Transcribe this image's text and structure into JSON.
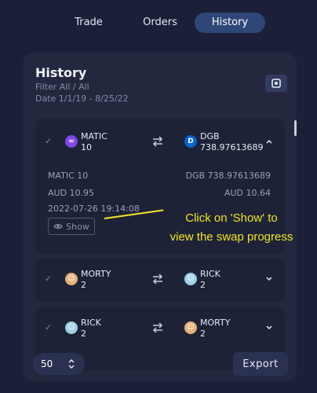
{
  "tabs": [
    {
      "label": "Trade",
      "active": false
    },
    {
      "label": "Orders",
      "active": false
    },
    {
      "label": "History",
      "active": true
    }
  ],
  "panel": {
    "title": "History",
    "filter": "Filter All / All",
    "date": "Date 1/1/19 - 8/25/22"
  },
  "swaps": [
    {
      "from": {
        "ticker": "MATIC",
        "amount": "10",
        "icon": "matic-icon",
        "color": "#8247e5"
      },
      "to": {
        "ticker": "DGB",
        "amount": "738.97613689",
        "icon": "dgb-icon",
        "color": "#0066cc"
      },
      "expanded": true,
      "details": {
        "from_amount": "MATIC 10",
        "to_amount": "DGB 738.97613689",
        "from_fiat": "AUD 10.95",
        "to_fiat": "AUD 10.64",
        "timestamp": "2022-07-26 19:14:08",
        "show_label": "Show"
      }
    },
    {
      "from": {
        "ticker": "MORTY",
        "amount": "2",
        "icon": "morty-icon",
        "color": "#e8b07a"
      },
      "to": {
        "ticker": "RICK",
        "amount": "2",
        "icon": "rick-icon",
        "color": "#9fd0e6"
      },
      "expanded": false
    },
    {
      "from": {
        "ticker": "RICK",
        "amount": "2",
        "icon": "rick-icon",
        "color": "#9fd0e6"
      },
      "to": {
        "ticker": "MORTY",
        "amount": "2",
        "icon": "morty-icon",
        "color": "#e8b07a"
      },
      "expanded": false
    }
  ],
  "footer": {
    "page_size": "50",
    "export_label": "Export"
  },
  "annotation": {
    "text_line1": "Click on 'Show' to",
    "text_line2": "view the swap progress",
    "color": "#f2e424"
  },
  "colors": {
    "background": "#1b1f37",
    "panel": "#24283f",
    "card": "#1e2237",
    "active_tab": "#2f4778",
    "check": "#4e8fd6"
  }
}
